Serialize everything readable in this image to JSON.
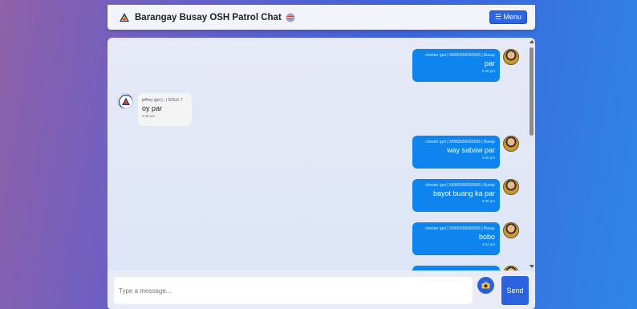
{
  "header": {
    "title": "Barangay Busay OSH Patrol Chat",
    "menu_label": "☰ Menu"
  },
  "messages": [
    {
      "direction": "out",
      "meta": "chester igot | 56565656565565 | Busay",
      "text": "par",
      "time": "3:38 pm"
    },
    {
      "direction": "in",
      "meta": "jeffrey igot | - | DOLE 7",
      "text": "oy par",
      "time": "3:38 pm"
    },
    {
      "direction": "out",
      "meta": "chester igot | 56565656565565 | Busay",
      "text": "way sabaw par",
      "time": "3:38 pm"
    },
    {
      "direction": "out",
      "meta": "chester igot | 56565656565565 | Busay",
      "text": "bayot buang ka par",
      "time": "3:38 pm"
    },
    {
      "direction": "out",
      "meta": "chester igot | 56565656565565 | Busay",
      "text": "bobo",
      "time": "4:34 pm"
    }
  ],
  "composer": {
    "placeholder": "Type a message...",
    "send_label": "Send",
    "camera_icon": "camera-icon"
  },
  "colors": {
    "accent": "#2b65e0",
    "outgoing_bubble": "#0d84ee",
    "incoming_bubble": "#f4f4f4"
  }
}
